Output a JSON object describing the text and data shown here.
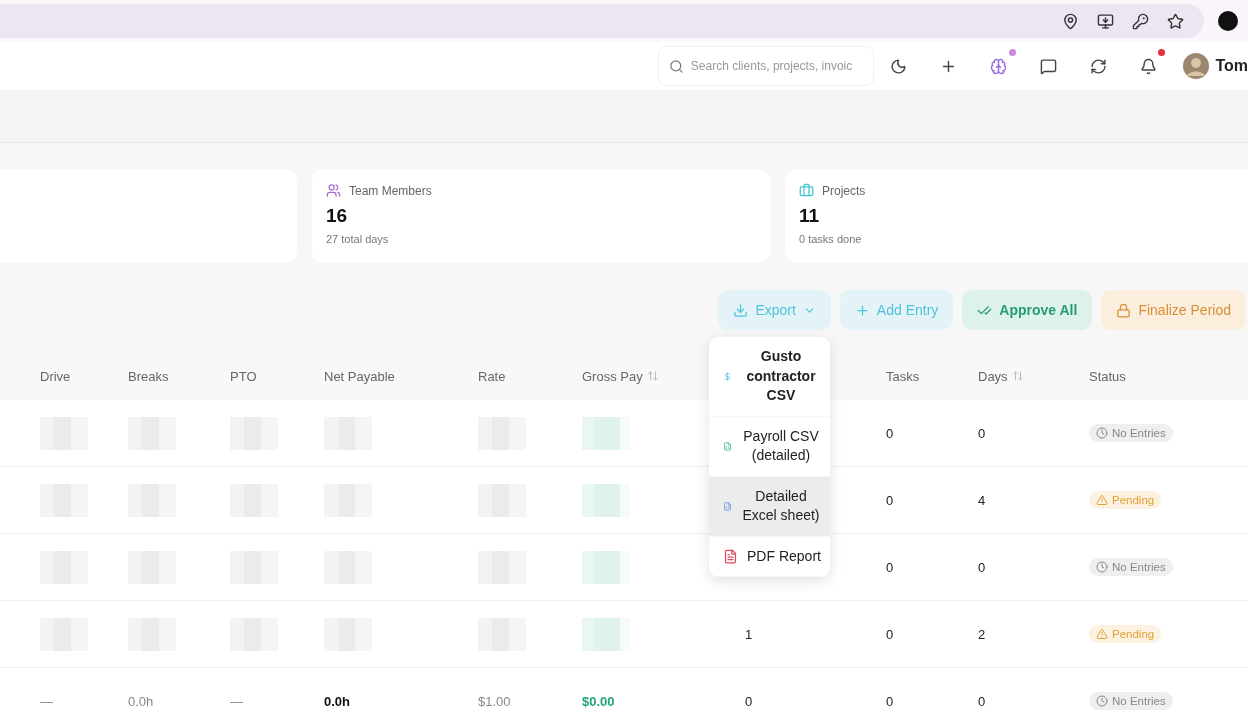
{
  "browser": {
    "toolbar_icons": [
      {
        "kind": "pin"
      },
      {
        "kind": "install"
      },
      {
        "kind": "key"
      },
      {
        "kind": "star"
      }
    ]
  },
  "header": {
    "search": {
      "placeholder": "Search clients, projects, invoic"
    },
    "actions": [
      {
        "kind": "theme",
        "notification": false
      },
      {
        "kind": "add",
        "notification": false
      },
      {
        "kind": "ai",
        "notification": true
      },
      {
        "kind": "chat",
        "notification": false
      },
      {
        "kind": "sync",
        "notification": false
      },
      {
        "kind": "alerts",
        "notification": true
      }
    ],
    "user": {
      "name": "Tom"
    }
  },
  "stats": [
    {
      "kind": "blank"
    },
    {
      "kind": "team",
      "label": "Team Members",
      "value": "16",
      "sub": "27 total days"
    },
    {
      "kind": "projects",
      "label": "Projects",
      "value": "11",
      "sub": "0 tasks done"
    }
  ],
  "actions": [
    {
      "kind": "export",
      "label": "Export"
    },
    {
      "kind": "add",
      "label": "Add Entry"
    },
    {
      "kind": "approve",
      "label": "Approve All"
    },
    {
      "kind": "finalize",
      "label": "Finalize Period"
    }
  ],
  "export_menu": [
    {
      "kind": "gusto",
      "label": "Gusto contractor CSV",
      "highlighted": false
    },
    {
      "kind": "payroll",
      "label": "Payroll CSV (detailed)",
      "highlighted": false
    },
    {
      "kind": "excel",
      "label": "Detailed Excel sheet)",
      "highlighted": true
    },
    {
      "kind": "pdf",
      "label": "PDF Report",
      "highlighted": false
    }
  ],
  "table": {
    "columns": [
      {
        "label": "Drive"
      },
      {
        "label": "Breaks"
      },
      {
        "label": "PTO"
      },
      {
        "label": "Net Payable"
      },
      {
        "label": "Rate"
      },
      {
        "label": "Gross Pay",
        "sortable": true
      },
      {},
      {
        "label": "Tasks"
      },
      {
        "label": "Days",
        "sortable": true
      }
    ],
    "rows": [
      {
        "cells": [
          {
            "kind": "redacted"
          },
          {
            "kind": "redacted"
          },
          {
            "kind": "redacted"
          },
          {
            "kind": "redacted"
          },
          {
            "kind": "redacted"
          },
          {
            "kind": "redacted_money"
          },
          {
            "kind": "covered"
          },
          {
            "kind": "text",
            "text": "0"
          },
          {
            "kind": "text",
            "text": "0"
          }
        ],
        "status": {
          "kind": "none",
          "label": "No Entries"
        }
      },
      {
        "cells": [
          {
            "kind": "redacted"
          },
          {
            "kind": "redacted"
          },
          {
            "kind": "redacted"
          },
          {
            "kind": "redacted"
          },
          {
            "kind": "redacted"
          },
          {
            "kind": "redacted_money"
          },
          {
            "kind": "covered"
          },
          {
            "kind": "text",
            "text": "0"
          },
          {
            "kind": "text",
            "text": "4"
          }
        ],
        "status": {
          "kind": "pending",
          "label": "Pending"
        }
      },
      {
        "cells": [
          {
            "kind": "redacted"
          },
          {
            "kind": "redacted"
          },
          {
            "kind": "redacted"
          },
          {
            "kind": "redacted"
          },
          {
            "kind": "redacted"
          },
          {
            "kind": "redacted_money"
          },
          {
            "kind": "covered"
          },
          {
            "kind": "text",
            "text": "0"
          },
          {
            "kind": "text",
            "text": "0"
          }
        ],
        "status": {
          "kind": "none",
          "label": "No Entries"
        }
      },
      {
        "cells": [
          {
            "kind": "redacted"
          },
          {
            "kind": "redacted"
          },
          {
            "kind": "redacted"
          },
          {
            "kind": "redacted"
          },
          {
            "kind": "redacted"
          },
          {
            "kind": "redacted_money"
          },
          {
            "kind": "text",
            "text": "1"
          },
          {
            "kind": "text",
            "text": "0"
          },
          {
            "kind": "text",
            "text": "2"
          }
        ],
        "status": {
          "kind": "pending",
          "label": "Pending"
        }
      },
      {
        "cells": [
          {
            "kind": "muted",
            "text": "—"
          },
          {
            "kind": "muted",
            "text": "0.0h"
          },
          {
            "kind": "muted",
            "text": "—"
          },
          {
            "kind": "strong",
            "text": "0.0h"
          },
          {
            "kind": "muted",
            "text": "$1.00"
          },
          {
            "kind": "money",
            "text": "$0.00"
          },
          {
            "kind": "text",
            "text": "0"
          },
          {
            "kind": "text",
            "text": "0"
          },
          {
            "kind": "text",
            "text": "0"
          }
        ],
        "status": {
          "kind": "none",
          "label": "No Entries"
        }
      }
    ],
    "status_label": "Status"
  }
}
